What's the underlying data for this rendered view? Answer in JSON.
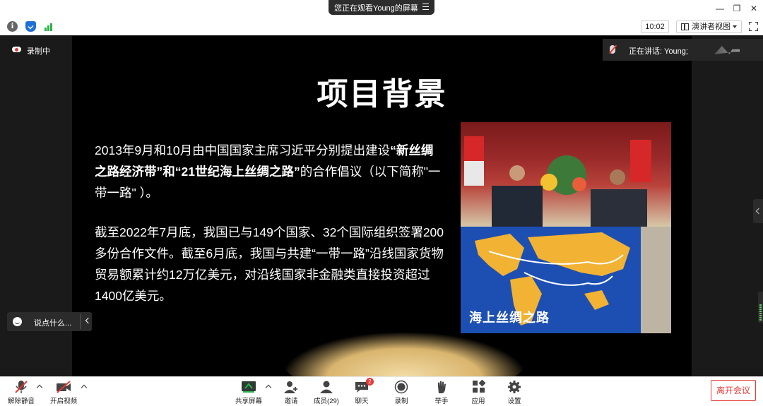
{
  "titlebar": {
    "share_notice": "您正在观看Young的屏幕",
    "minimize": "—",
    "restore": "❐",
    "close": "✕"
  },
  "toolbar": {
    "time": "10:02",
    "view_mode": "演讲者视图"
  },
  "recording": {
    "label": "录制中"
  },
  "speaker": {
    "label": "正在讲话: Young;"
  },
  "slide": {
    "title": "项目背景",
    "paragraph1": {
      "part1": "2013年9月和10月由中国国家主席习近平分别提出建设",
      "bold1": "“新丝绸之路经济带”和“21世纪海上丝绸之路”",
      "part2": "的合作倡议（以下简称\"一带一路\" ）。"
    },
    "paragraph2": "截至2022年7月底，我国已与149个国家、32个国际组织签署200多份合作文件。截至6月底，我国与共建“一带一路”沿线国家货物贸易额累计约12万亿美元，对沿线国家非金融类直接投资超过1400亿美元。",
    "map_caption": "海上丝绸之路"
  },
  "chat": {
    "placeholder": "说点什么..."
  },
  "bottombar": {
    "unmute": "解除静音",
    "start_video": "开启视频",
    "share_screen": "共享屏幕",
    "invite": "邀请",
    "members": "成员(29)",
    "chat": "聊天",
    "chat_badge": "2",
    "record": "录制",
    "raise_hand": "举手",
    "apps": "应用",
    "settings": "设置",
    "leave": "离开会议"
  },
  "colors": {
    "accent_red": "#e53935",
    "slide_bg": "#000000",
    "share_green": "#2bb24c"
  }
}
